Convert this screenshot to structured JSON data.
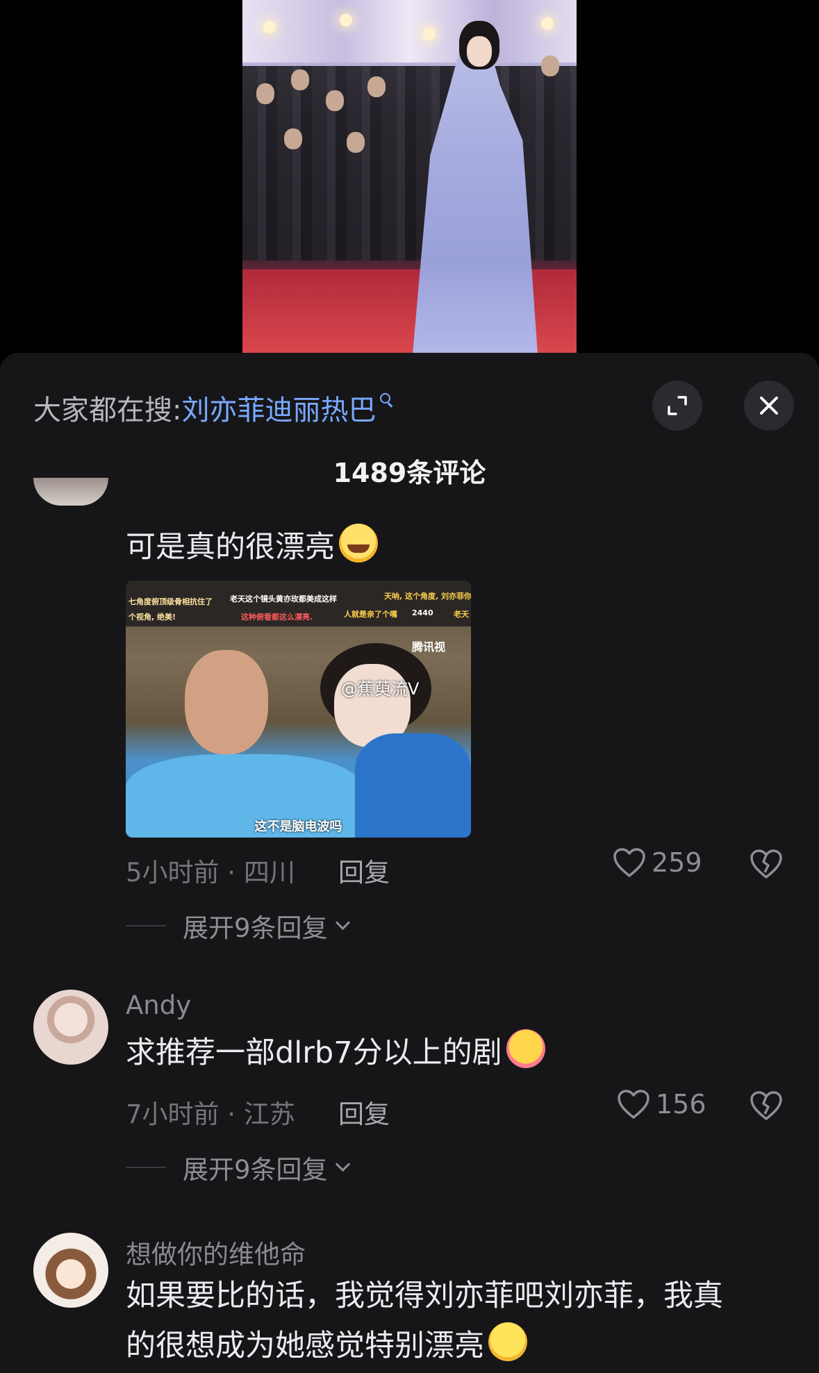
{
  "search": {
    "prefix": "大家都在搜:",
    "keyword": "刘亦菲迪丽热巴"
  },
  "header": {
    "comment_count": "1489条评论"
  },
  "comments": [
    {
      "username": "",
      "text": "可是真的很漂亮",
      "emoji": "crying-face",
      "image": {
        "overlay_texts": [
          "七角度俯顶级骨相抗住了",
          "老天这个镜头黄亦玫都美成这样",
          "天呐, 这个角度, 刘亦菲你太太",
          "个视角, 绝美!",
          "这种俯看都这么漂亮.",
          "人就是亲了个嘴",
          "2440",
          "老天"
        ],
        "logo": "腾讯视",
        "watermark": "@蕉萸流V",
        "subtitle": "这不是脑电波吗"
      },
      "time_location": "5小时前 · 四川",
      "reply_label": "回复",
      "likes": "259",
      "expand_label": "展开9条回复"
    },
    {
      "username": "Andy",
      "text": "求推荐一部dlrb7分以上的剧",
      "emoji": "hugging-face",
      "time_location": "7小时前 · 江苏",
      "reply_label": "回复",
      "likes": "156",
      "expand_label": "展开9条回复"
    },
    {
      "username": "想做你的维他命",
      "text_line1": "如果要比的话，我觉得刘亦菲吧刘亦菲，我真",
      "text_line2": "的很想成为她感觉特别漂亮",
      "emoji": "smirking-face"
    }
  ],
  "colors": {
    "sheet_bg": "#161618",
    "link": "#7aa9ff",
    "meta_text": "#75757a"
  },
  "icons": [
    "search-icon",
    "expand-icon",
    "close-icon",
    "heart-icon",
    "broken-heart-icon",
    "chevron-down-icon"
  ]
}
